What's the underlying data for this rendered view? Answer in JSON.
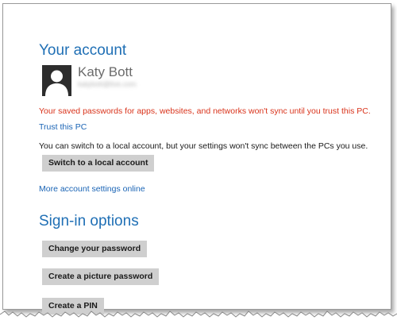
{
  "account": {
    "title": "Your account",
    "user_name": "Katy Bott",
    "user_email": "katybott@live.com",
    "warning": "Your saved passwords for apps, websites, and networks won't sync until you trust this PC.",
    "trust_link": "Trust this PC",
    "local_info": "You can switch to a local account, but your settings won't sync between the PCs you use.",
    "switch_button": "Switch to a local account",
    "more_settings_link": "More account settings online"
  },
  "signin": {
    "title": "Sign-in options",
    "change_password_button": "Change your password",
    "picture_password_button": "Create a picture password",
    "pin_button": "Create a PIN"
  },
  "colors": {
    "heading": "#1f6fb5",
    "link": "#1a64b5",
    "warning": "#d9331b",
    "button_bg": "#cfcfcf",
    "avatar_bg": "#2d2d2d"
  }
}
